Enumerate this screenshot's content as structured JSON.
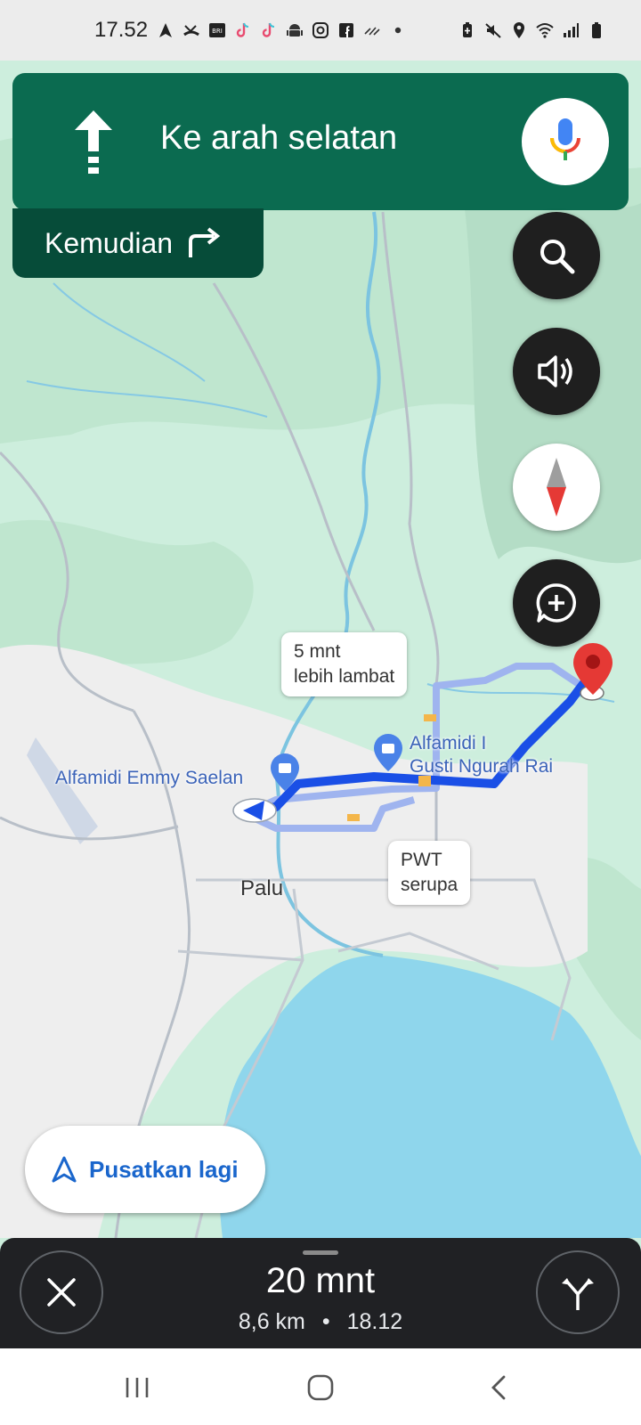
{
  "status_bar": {
    "time": "17.52",
    "left_icons": [
      "navigation-arrow-icon",
      "missed-call-icon",
      "brimo-icon",
      "tiktok-icon",
      "tiktok-icon",
      "android-icon",
      "instagram-icon",
      "facebook-icon",
      "signal-icon",
      "dot-icon"
    ],
    "right_icons": [
      "battery-saver-icon",
      "mute-icon",
      "location-icon",
      "wifi-icon",
      "cell-signal-icon",
      "battery-icon"
    ]
  },
  "navigation": {
    "instruction": "Ke arah selatan",
    "direction_icon": "straight-arrow-icon",
    "then_label": "Kemudian",
    "then_icon": "turn-right-icon"
  },
  "map_controls": {
    "search_icon": "search-icon",
    "sound_icon": "volume-icon",
    "compass_icon": "compass-icon",
    "report_icon": "add-report-icon"
  },
  "map": {
    "places": [
      {
        "name": "Alfamidi Emmy Saelan"
      },
      {
        "name": "Alfamidi I\nGusti Ngurah Rai"
      }
    ],
    "city": "Palu",
    "callouts": {
      "slower": {
        "line1": "5 mnt",
        "line2": "lebih lambat"
      },
      "similar": {
        "line1": "PWT",
        "line2": "serupa"
      }
    },
    "colors": {
      "route": "#1a4fe6",
      "alt_route": "#9fb4ef",
      "water": "#8fd6ec",
      "land": "#cdeedd"
    }
  },
  "recenter": {
    "label": "Pusatkan lagi"
  },
  "trip": {
    "eta": "20 mnt",
    "distance": "8,6 km",
    "separator": "•",
    "arrival": "18.12"
  },
  "system_nav": {
    "recents": "recents-icon",
    "home": "home-icon",
    "back": "back-icon"
  }
}
